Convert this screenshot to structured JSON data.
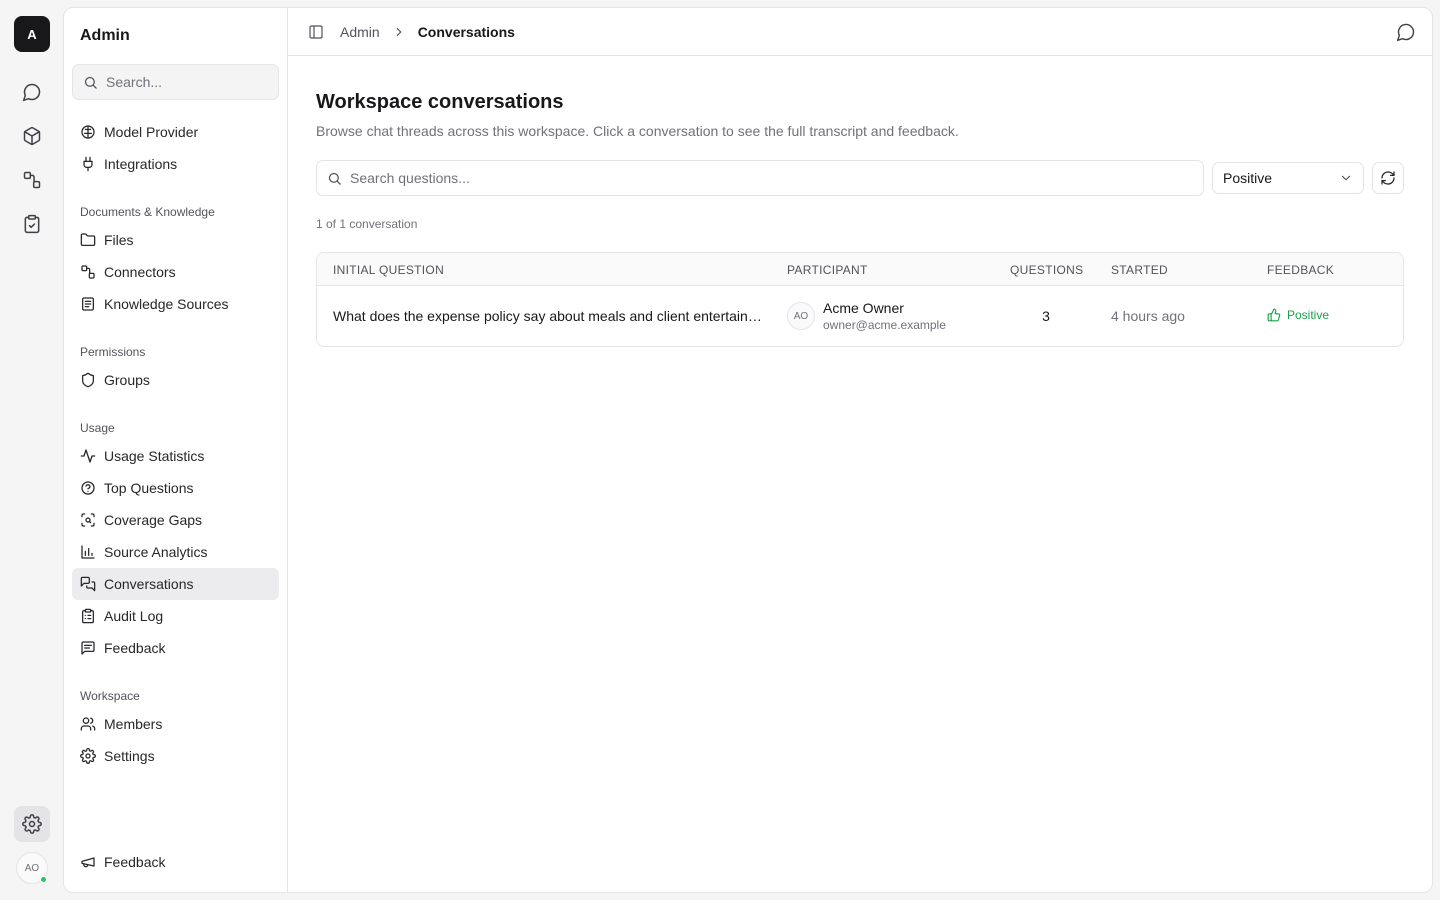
{
  "rail": {
    "logo": "A",
    "avatar": "AO",
    "items": [
      {
        "name": "chat-icon"
      },
      {
        "name": "cube-icon"
      },
      {
        "name": "connectors-icon"
      },
      {
        "name": "clipboard-check-icon"
      }
    ]
  },
  "sidebar": {
    "title": "Admin",
    "search_placeholder": "Search...",
    "top_items": [
      "Model Provider",
      "Integrations"
    ],
    "sections": [
      {
        "title": "Documents & Knowledge",
        "items": [
          "Files",
          "Connectors",
          "Knowledge Sources"
        ]
      },
      {
        "title": "Permissions",
        "items": [
          "Groups"
        ]
      },
      {
        "title": "Usage",
        "items": [
          "Usage Statistics",
          "Top Questions",
          "Coverage Gaps",
          "Source Analytics",
          "Conversations",
          "Audit Log",
          "Feedback"
        ]
      },
      {
        "title": "Workspace",
        "items": [
          "Members",
          "Settings"
        ]
      }
    ],
    "footer_item": "Feedback",
    "active_item": "Conversations"
  },
  "breadcrumb": {
    "parent": "Admin",
    "current": "Conversations"
  },
  "page": {
    "title": "Workspace conversations",
    "subtitle": "Browse chat threads across this workspace. Click a conversation to see the full transcript and feedback.",
    "search_placeholder": "Search questions...",
    "filter_value": "Positive",
    "count_text": "1 of 1 conversation"
  },
  "table": {
    "headers": [
      "INITIAL QUESTION",
      "PARTICIPANT",
      "QUESTIONS",
      "STARTED",
      "FEEDBACK"
    ],
    "rows": [
      {
        "question": "What does the expense policy say about meals and client entertainment?",
        "avatar": "AO",
        "participant_name": "Acme Owner",
        "participant_email": "owner@acme.example",
        "questions": "3",
        "started": "4 hours ago",
        "feedback": "Positive"
      }
    ]
  },
  "colors": {
    "accent": "#18181b",
    "positive": "#16a34a",
    "online": "#22c55e"
  }
}
